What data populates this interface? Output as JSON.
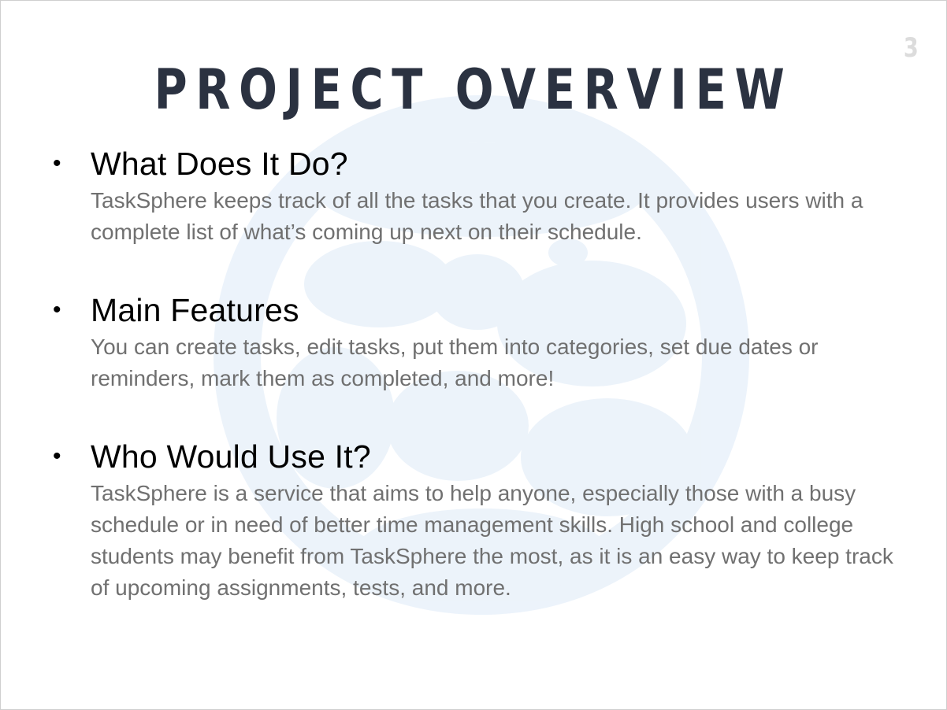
{
  "slide": {
    "number": "3",
    "title": "PROJECT OVERVIEW"
  },
  "bullets": [
    {
      "heading": "What Does It Do?",
      "body": "TaskSphere keeps track of all the tasks that you create. It provides users with a complete list of what’s coming up next on their schedule."
    },
    {
      "heading": "Main Features",
      "body": "You can create tasks, edit tasks, put them into categories, set due dates or reminders, mark them as completed, and more!"
    },
    {
      "heading": "Who Would Use It?",
      "body": "TaskSphere is a service that aims to help anyone, especially those with a busy schedule or in need of better time management skills. High school and college students may benefit from TaskSphere the most, as it is an easy way to keep track of upcoming assignments, tests, and more."
    }
  ],
  "colors": {
    "title": "#2b3241",
    "body_text": "#707070",
    "watermark": "#dfe9f5",
    "slide_number": "#dcdcdc"
  }
}
